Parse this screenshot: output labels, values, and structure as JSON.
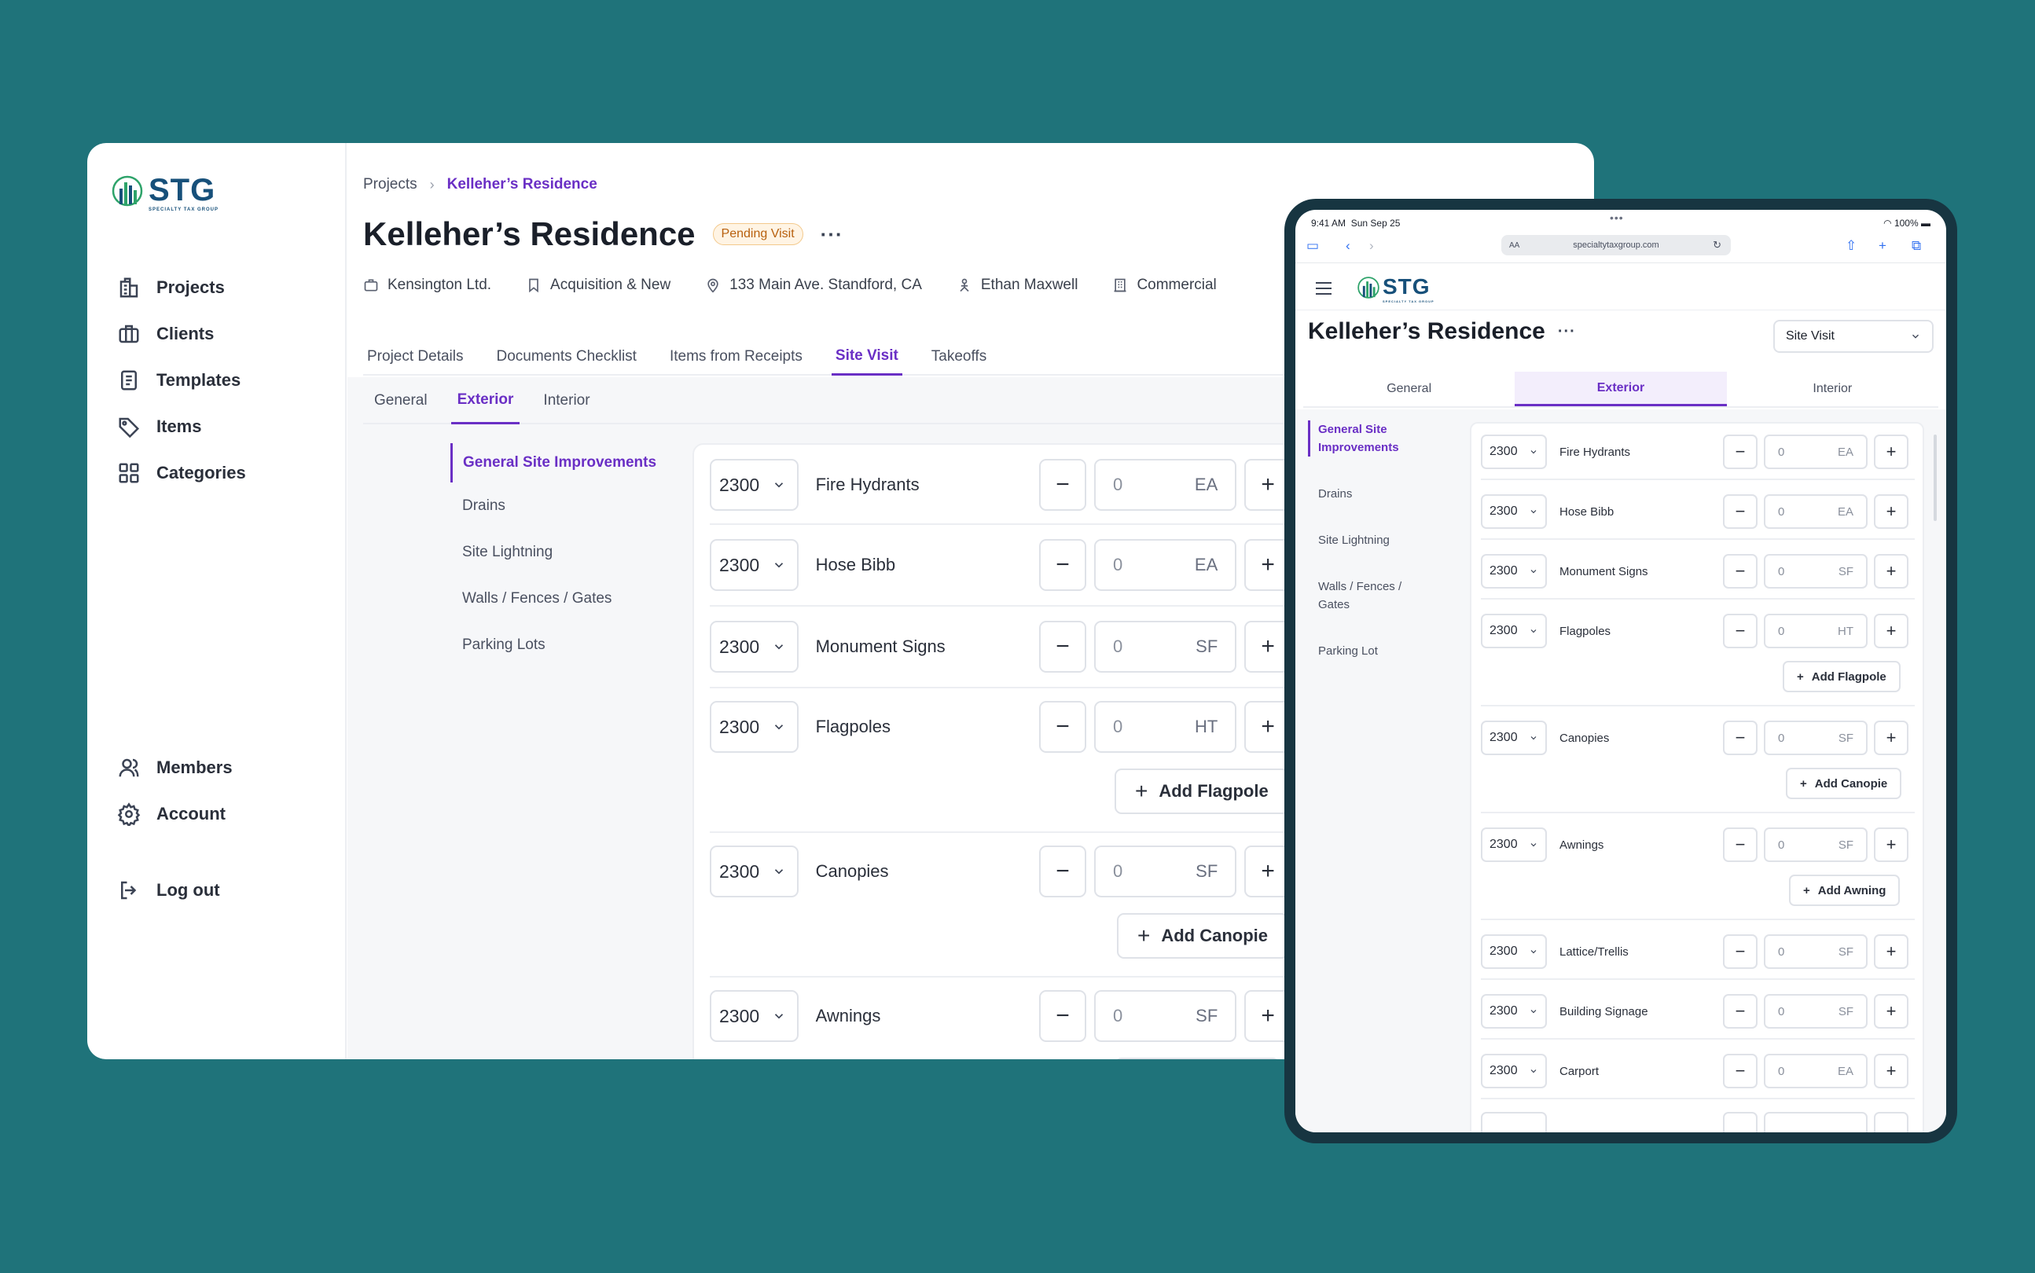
{
  "brand": {
    "name": "STG",
    "tagline": "SPECIALTY TAX GROUP",
    "color": "#17507a",
    "accent": "#6a2fc5"
  },
  "sidebar": {
    "items": [
      {
        "label": "Projects",
        "icon": "building-icon"
      },
      {
        "label": "Clients",
        "icon": "briefcase-icon"
      },
      {
        "label": "Templates",
        "icon": "document-icon"
      },
      {
        "label": "Items",
        "icon": "tag-icon"
      },
      {
        "label": "Categories",
        "icon": "grid-icon"
      }
    ],
    "bottom": [
      {
        "label": "Members",
        "icon": "users-icon"
      },
      {
        "label": "Account",
        "icon": "gear-icon"
      },
      {
        "label": "Log out",
        "icon": "logout-icon"
      }
    ]
  },
  "breadcrumb": {
    "root": "Projects",
    "current": "Kelleher’s Residence"
  },
  "project": {
    "title": "Kelleher’s Residence",
    "status": "Pending Visit",
    "meta": {
      "client": "Kensington Ltd.",
      "type": "Acquisition & New",
      "address": "133 Main Ave. Standford, CA",
      "person": "Ethan Maxwell",
      "category": "Commercial"
    }
  },
  "tabs": [
    "Project Details",
    "Documents Checklist",
    "Items from Receipts",
    "Site Visit",
    "Takeoffs"
  ],
  "subtabs": [
    "General",
    "Exterior",
    "Interior"
  ],
  "categories": [
    "General Site Improvements",
    "Drains",
    "Site Lightning",
    "Walls / Fences / Gates",
    "Parking Lots"
  ],
  "rows": [
    {
      "code": "2300",
      "label": "Fire Hydrants",
      "qty": "0",
      "unit": "EA"
    },
    {
      "code": "2300",
      "label": "Hose Bibb",
      "qty": "0",
      "unit": "EA"
    },
    {
      "code": "2300",
      "label": "Monument Signs",
      "qty": "0",
      "unit": "SF"
    },
    {
      "code": "2300",
      "label": "Flagpoles",
      "qty": "0",
      "unit": "HT"
    },
    {
      "code": "2300",
      "label": "Canopies",
      "qty": "0",
      "unit": "SF"
    },
    {
      "code": "2300",
      "label": "Awnings",
      "qty": "0",
      "unit": "SF"
    }
  ],
  "add_buttons": {
    "flagpole": "Add Flagpole",
    "canopie": "Add Canopie",
    "awning": "Add Awning"
  },
  "tablet": {
    "time": "9:41 AM",
    "date": "Sun Sep 25",
    "battery": "100%",
    "url": "specialtytaxgroup.com",
    "text_size": "AA",
    "stage_select": "Site Visit",
    "categories": [
      "General Site Improvements",
      "Drains",
      "Site Lightning",
      "Walls / Fences / Gates",
      "Parking Lot"
    ],
    "rows": [
      {
        "code": "2300",
        "label": "Fire Hydrants",
        "qty": "0",
        "unit": "EA"
      },
      {
        "code": "2300",
        "label": "Hose Bibb",
        "qty": "0",
        "unit": "EA"
      },
      {
        "code": "2300",
        "label": "Monument Signs",
        "qty": "0",
        "unit": "SF"
      },
      {
        "code": "2300",
        "label": "Flagpoles",
        "qty": "0",
        "unit": "HT"
      },
      {
        "code": "2300",
        "label": "Canopies",
        "qty": "0",
        "unit": "SF"
      },
      {
        "code": "2300",
        "label": "Awnings",
        "qty": "0",
        "unit": "SF"
      },
      {
        "code": "2300",
        "label": "Lattice/Trellis",
        "qty": "0",
        "unit": "SF"
      },
      {
        "code": "2300",
        "label": "Building Signage",
        "qty": "0",
        "unit": "SF"
      },
      {
        "code": "2300",
        "label": "Carport",
        "qty": "0",
        "unit": "EA"
      }
    ]
  }
}
